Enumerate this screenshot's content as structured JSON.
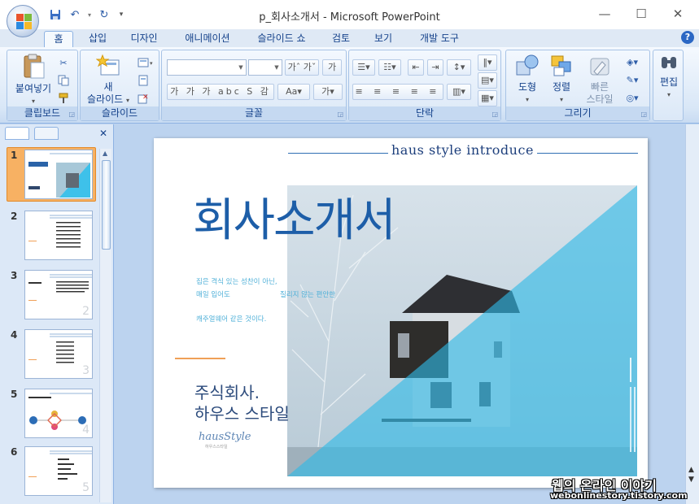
{
  "window": {
    "title": "p_회사소개서 - Microsoft PowerPoint"
  },
  "tabs": [
    {
      "label": "홈"
    },
    {
      "label": "삽입"
    },
    {
      "label": "디자인"
    },
    {
      "label": "애니메이션"
    },
    {
      "label": "슬라이드 쇼"
    },
    {
      "label": "검토"
    },
    {
      "label": "보기"
    },
    {
      "label": "개발 도구"
    }
  ],
  "ribbon": {
    "clipboard": {
      "label": "클립보드",
      "paste": "붙여넣기"
    },
    "slides": {
      "label": "슬라이드",
      "new_slide_1": "새",
      "new_slide_2": "슬라이드"
    },
    "font": {
      "label": "글꼴"
    },
    "paragraph": {
      "label": "단락"
    },
    "drawing": {
      "label": "그리기",
      "shapes": "도형",
      "arrange": "정렬",
      "quick_styles_1": "빠른",
      "quick_styles_2": "스타일"
    },
    "editing": {
      "label": "편집"
    }
  },
  "panel": {
    "thumbnails": [
      {
        "num": "1",
        "page": ""
      },
      {
        "num": "2",
        "page": ""
      },
      {
        "num": "3",
        "page": "2"
      },
      {
        "num": "4",
        "page": "3"
      },
      {
        "num": "5",
        "page": "4"
      },
      {
        "num": "6",
        "page": "5"
      }
    ]
  },
  "slide": {
    "intro": "haus style introduce",
    "heading": "회사소개서",
    "body_line1": "집은 격식 있는 성찬이 아닌,",
    "body_line2a": "매일 입어도",
    "body_line2b": "질리지 않는 편안한",
    "body_line3": "캐주얼웨어 같은 것이다.",
    "company_1": "주식회사.",
    "company_2": "하우스 스타일",
    "logo": "hausStyle",
    "logo_sub": "하우스스타일"
  },
  "watermark": {
    "line1": "웹의 온라인 이야기",
    "line2": "webonlinestory.tistory.com"
  },
  "colors": {
    "accent_blue": "#1d5ea8",
    "cyan": "#2fb9e6",
    "orange": "#f0a057"
  }
}
